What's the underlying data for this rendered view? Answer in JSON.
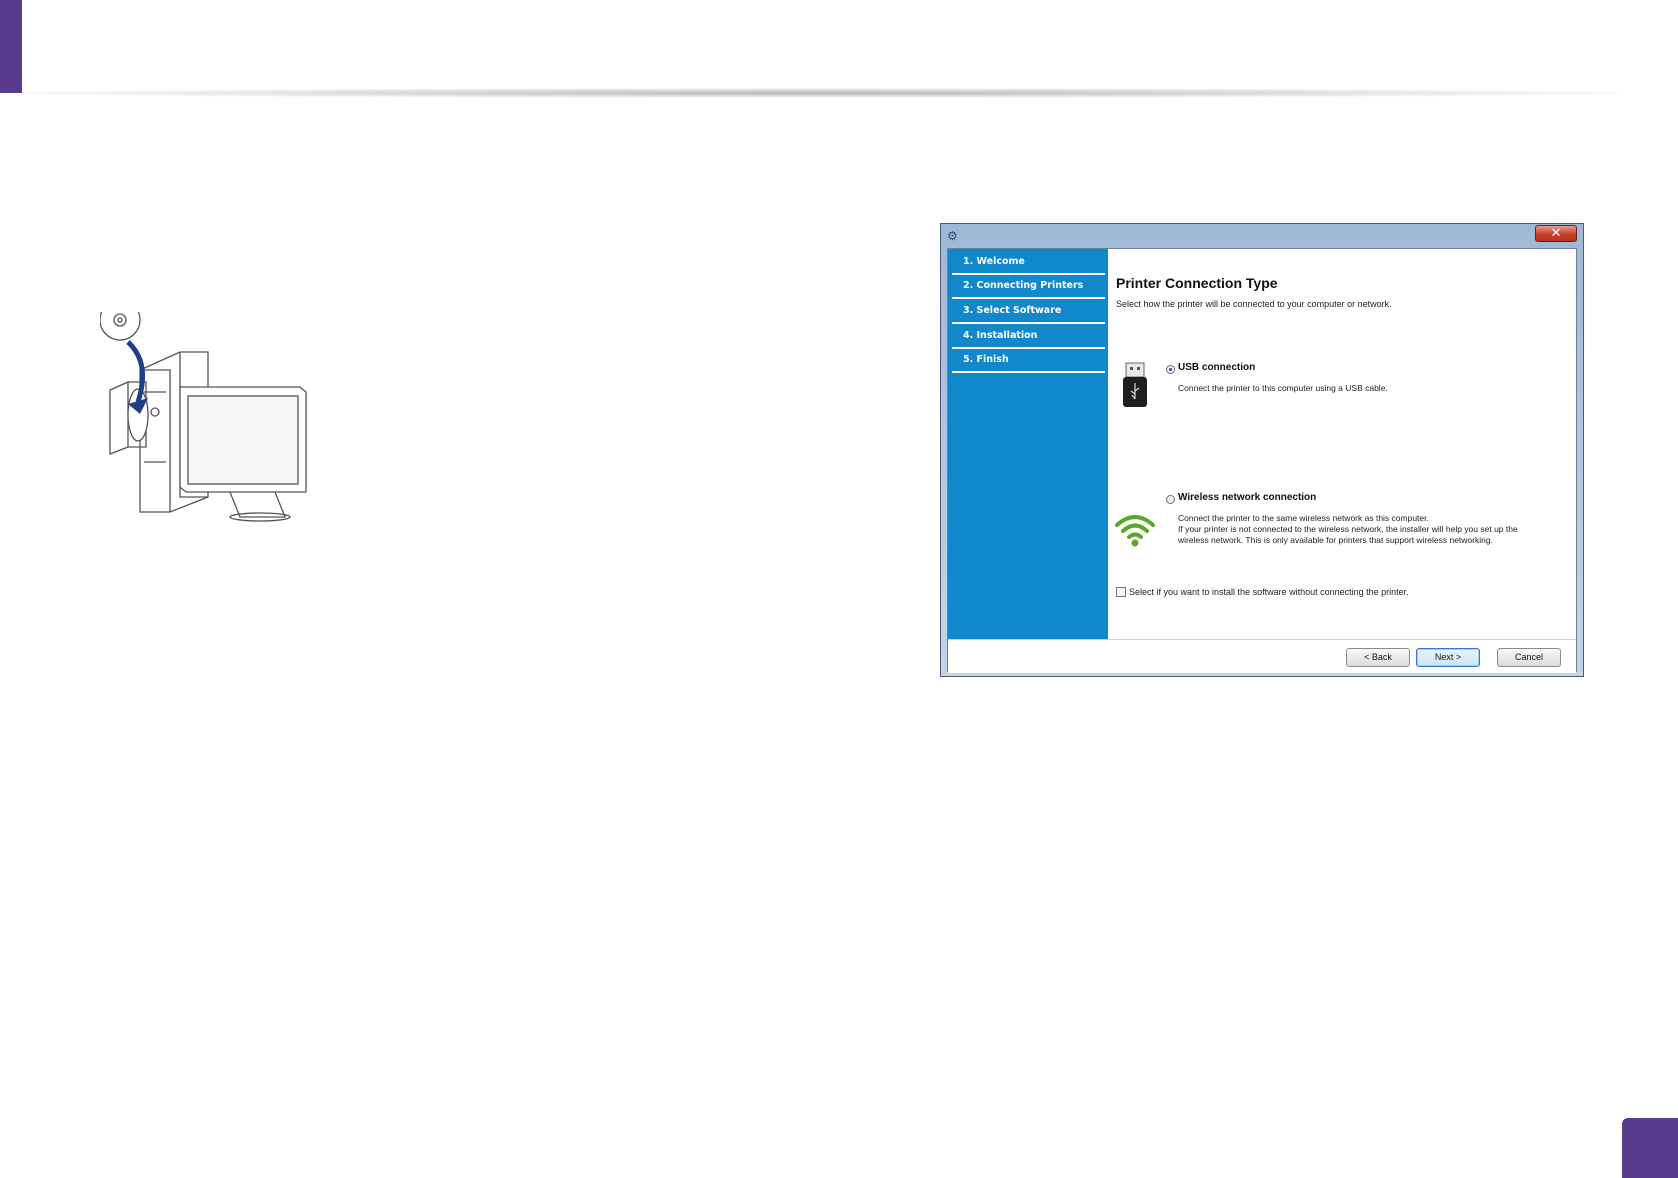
{
  "installer": {
    "close_glyph": "✕",
    "steps": [
      {
        "label": "1. Welcome"
      },
      {
        "label": "2. Connecting Printers"
      },
      {
        "label": "3. Select Software"
      },
      {
        "label": "4. Installation"
      },
      {
        "label": "5. Finish"
      }
    ],
    "title": "Printer Connection Type",
    "subtitle": "Select how the printer will be connected to your computer or network.",
    "options": [
      {
        "title": "USB connection",
        "selected": true,
        "icon": "usb-icon",
        "description": [
          "Connect the printer to this computer using a USB cable."
        ]
      },
      {
        "title": "Wireless network connection",
        "selected": false,
        "icon": "wifi-icon",
        "description": [
          "Connect the printer to the same wireless network as this computer.",
          "If your printer is not connected to the wireless network, the installer will help you set up the",
          "wireless network. This is only available for printers that support wireless networking."
        ]
      }
    ],
    "skip_checkbox": {
      "label": "Select if you want to install the software without connecting the printer.",
      "checked": false
    },
    "buttons": {
      "back": "< Back",
      "next": "Next >",
      "cancel": "Cancel"
    }
  },
  "colors": {
    "accent": "#5a3a8c",
    "sidebar": "#1188cc"
  }
}
